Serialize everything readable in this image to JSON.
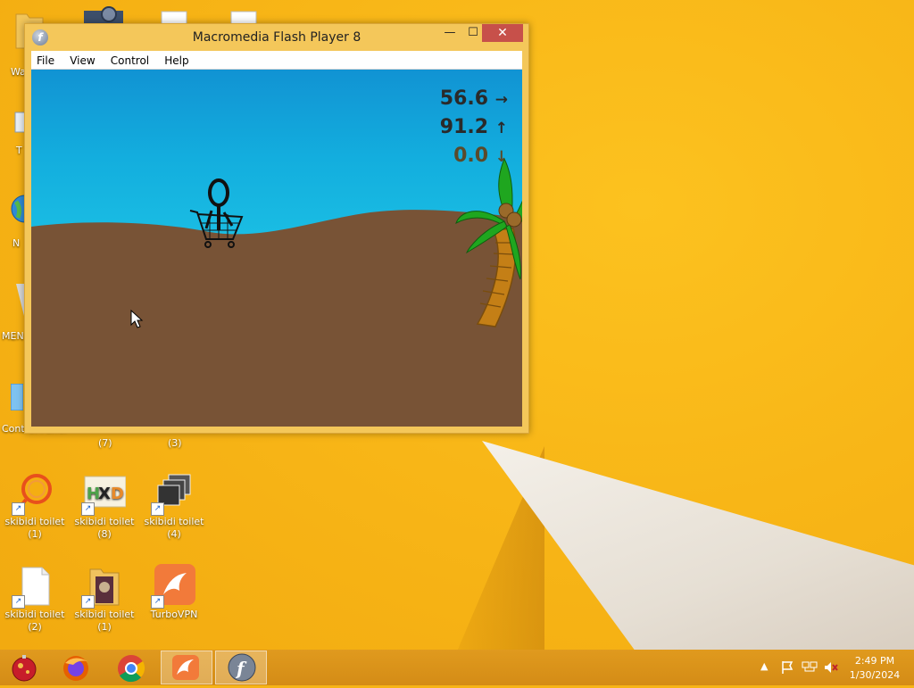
{
  "window": {
    "title": "Macromedia Flash Player 8",
    "menu": [
      "File",
      "View",
      "Control",
      "Help"
    ],
    "controls": {
      "minimize": "—",
      "maximize": "☐",
      "close": "✕"
    }
  },
  "game": {
    "hud": [
      {
        "value": "56.6",
        "arrow": "→"
      },
      {
        "value": "91.2",
        "arrow": "↑"
      },
      {
        "value": "0.0",
        "arrow": "↓"
      }
    ],
    "colors": {
      "sky": "#13aede",
      "sand": "#785336",
      "palm_leaf": "#1fa61f",
      "trunk": "#c47f16"
    }
  },
  "desktop": {
    "partial_labels": [
      "Wa",
      "T",
      "N",
      "MEN",
      "Control Panel",
      "(7)",
      "(3)"
    ],
    "icons": [
      {
        "label_line1": "skibidi toilet",
        "label_line2": "(1)",
        "icon": "audio-ring-icon"
      },
      {
        "label_line1": "skibidi toilet",
        "label_line2": "(8)",
        "icon": "hxd-editor-icon"
      },
      {
        "label_line1": "skibidi toilet",
        "label_line2": "(4)",
        "icon": "window-stack-icon"
      },
      {
        "label_line1": "skibidi toilet",
        "label_line2": "(2)",
        "icon": "blank-document-icon"
      },
      {
        "label_line1": "skibidi toilet",
        "label_line2": "(1)",
        "icon": "media-folder-icon"
      },
      {
        "label_line1": "TurboVPN",
        "label_line2": "",
        "icon": "turbovpn-icon"
      }
    ]
  },
  "taskbar": {
    "apps": [
      "ornament-icon",
      "firefox-icon",
      "chrome-icon",
      "turbovpn-icon",
      "flash-player-icon"
    ],
    "clock": {
      "time": "2:49 PM",
      "date": "1/30/2024"
    }
  }
}
